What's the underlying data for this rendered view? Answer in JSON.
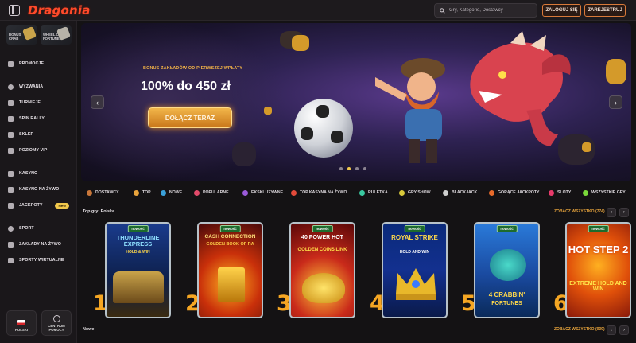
{
  "header": {
    "logo": "Dragonia",
    "search_placeholder": "Gry, Kategorie, Dostawcy",
    "login_label": "ZALOGUJ SIĘ",
    "register_label": "ZAREJESTRUJ"
  },
  "sidebar": {
    "tiles": [
      {
        "label_line1": "BONUS",
        "label_line2": "CRAB"
      },
      {
        "label_line1": "WHEEL OF",
        "label_line2": "FORTUNE"
      }
    ],
    "items": [
      {
        "label": "PROMOCJE",
        "icon": "gift-icon"
      },
      {
        "label": "WYZWANIA",
        "icon": "target-icon"
      },
      {
        "label": "TURNIEJE",
        "icon": "trophy-icon"
      },
      {
        "label": "SPIN RALLY",
        "icon": "flag-icon"
      },
      {
        "label": "SKLEP",
        "icon": "shop-icon"
      },
      {
        "label": "POZIOMY VIP",
        "icon": "crown-icon"
      },
      {
        "label": "KASYNO",
        "icon": "slot-icon"
      },
      {
        "label": "KASYNO NA ŻYWO",
        "icon": "live-icon"
      },
      {
        "label": "JACKPOTY",
        "icon": "jackpot-icon",
        "badge": "New"
      },
      {
        "label": "SPORT",
        "icon": "ball-icon"
      },
      {
        "label": "ZAKŁADY NA ŻYWO",
        "icon": "live-bet-icon"
      },
      {
        "label": "SPORTY WIRTUALNE",
        "icon": "virtual-icon"
      }
    ],
    "language_label": "POLSKI",
    "help_label_line1": "CENTRUM",
    "help_label_line2": "POMOCY"
  },
  "hero": {
    "subtitle": "BONUS ZAKŁADÓW OD PIERWSZEJ WPŁATY",
    "title": "100% do 450 zł",
    "cta": "DOŁĄCZ TERAZ",
    "slides": 4,
    "active_slide": 2
  },
  "categories": [
    {
      "label": "DOSTAWCY",
      "color": "#c9773a"
    },
    {
      "label": "TOP",
      "color": "#e8a33c"
    },
    {
      "label": "NOWE",
      "color": "#3aa0d9"
    },
    {
      "label": "POPULARNE",
      "color": "#e24a6a"
    },
    {
      "label": "EKSKLUZYWNE",
      "color": "#9a5ad9"
    },
    {
      "label": "TOP KASYNA NA ŻYWO",
      "color": "#e24a3a"
    },
    {
      "label": "RULETKA",
      "color": "#3ac9a0"
    },
    {
      "label": "GRY SHOW",
      "color": "#d9c93a"
    },
    {
      "label": "BLACKJACK",
      "color": "#cfcfcf"
    },
    {
      "label": "GORĄCE JACKPOTY",
      "color": "#e86a2a"
    },
    {
      "label": "SLOTY",
      "color": "#e83a6a"
    },
    {
      "label": "WSZYSTKIE GRY",
      "color": "#7ad93a"
    }
  ],
  "top_games": {
    "title": "Top gry: Polska",
    "more_label": "ZOBACZ WSZYSTKO (774)",
    "badge": "nowość",
    "games": [
      {
        "rank": "1",
        "title": "THUNDERLINE EXPRESS",
        "sub": "HOLD & WIN"
      },
      {
        "rank": "2",
        "title": "CASH CONNECTION",
        "sub": "GOLDEN BOOK OF RA"
      },
      {
        "rank": "3",
        "title": "40 POWER HOT",
        "sub": "GOLDEN COINS LINK"
      },
      {
        "rank": "4",
        "title": "ROYAL STRIKE",
        "sub": "HOLD AND WIN"
      },
      {
        "rank": "5",
        "title": "4 CRABBIN'",
        "sub": "FORTUNES"
      },
      {
        "rank": "6",
        "title": "HOT STEP 2",
        "sub": "EXTREME HOLD AND WIN"
      }
    ]
  },
  "new_games": {
    "title": "Nowe",
    "more_label": "ZOBACZ WSZYSTKO (939)"
  }
}
